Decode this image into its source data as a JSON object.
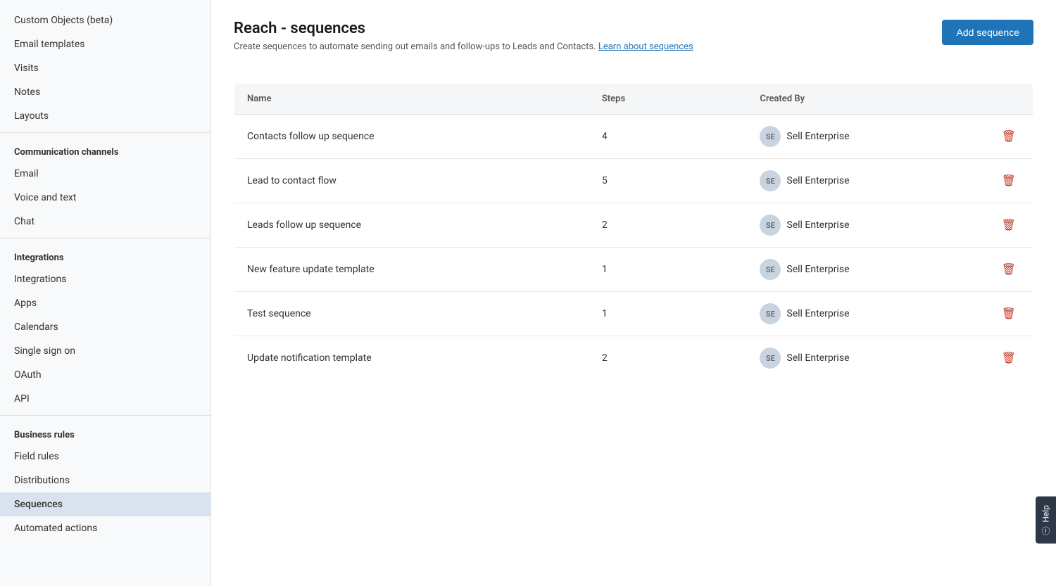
{
  "sidebar": {
    "items_top": [
      {
        "id": "custom-objects",
        "label": "Custom Objects (beta)",
        "active": false
      },
      {
        "id": "email-templates",
        "label": "Email templates",
        "active": false
      },
      {
        "id": "visits",
        "label": "Visits",
        "active": false
      },
      {
        "id": "notes",
        "label": "Notes",
        "active": false
      },
      {
        "id": "layouts",
        "label": "Layouts",
        "active": false
      }
    ],
    "sections": [
      {
        "header": "Communication channels",
        "items": [
          {
            "id": "email",
            "label": "Email",
            "active": false
          },
          {
            "id": "voice-and-text",
            "label": "Voice and text",
            "active": false
          },
          {
            "id": "chat",
            "label": "Chat",
            "active": false
          }
        ]
      },
      {
        "header": "Integrations",
        "items": [
          {
            "id": "integrations",
            "label": "Integrations",
            "active": false
          },
          {
            "id": "apps",
            "label": "Apps",
            "active": false
          },
          {
            "id": "calendars",
            "label": "Calendars",
            "active": false
          },
          {
            "id": "single-sign-on",
            "label": "Single sign on",
            "active": false
          },
          {
            "id": "oauth",
            "label": "OAuth",
            "active": false
          },
          {
            "id": "api",
            "label": "API",
            "active": false
          }
        ]
      },
      {
        "header": "Business rules",
        "items": [
          {
            "id": "field-rules",
            "label": "Field rules",
            "active": false
          },
          {
            "id": "distributions",
            "label": "Distributions",
            "active": false
          },
          {
            "id": "sequences",
            "label": "Sequences",
            "active": true
          },
          {
            "id": "automated-actions",
            "label": "Automated actions",
            "active": false
          }
        ]
      }
    ]
  },
  "main": {
    "title": "Reach - sequences",
    "description": "Create sequences to automate sending out emails and follow-ups to Leads and Contacts.",
    "learn_link": "Learn about sequences",
    "add_button": "Add sequence",
    "table": {
      "headers": [
        {
          "id": "name",
          "label": "Name"
        },
        {
          "id": "steps",
          "label": "Steps"
        },
        {
          "id": "created-by",
          "label": "Created By"
        }
      ],
      "rows": [
        {
          "name": "Contacts follow up sequence",
          "steps": "4",
          "avatar": "SE",
          "creator": "Sell Enterprise"
        },
        {
          "name": "Lead to contact flow",
          "steps": "5",
          "avatar": "SE",
          "creator": "Sell Enterprise"
        },
        {
          "name": "Leads follow up sequence",
          "steps": "2",
          "avatar": "SE",
          "creator": "Sell Enterprise"
        },
        {
          "name": "New feature update template",
          "steps": "1",
          "avatar": "SE",
          "creator": "Sell Enterprise"
        },
        {
          "name": "Test sequence",
          "steps": "1",
          "avatar": "SE",
          "creator": "Sell Enterprise"
        },
        {
          "name": "Update notification template",
          "steps": "2",
          "avatar": "SE",
          "creator": "Sell Enterprise"
        }
      ]
    }
  },
  "help": {
    "label": "Help"
  }
}
